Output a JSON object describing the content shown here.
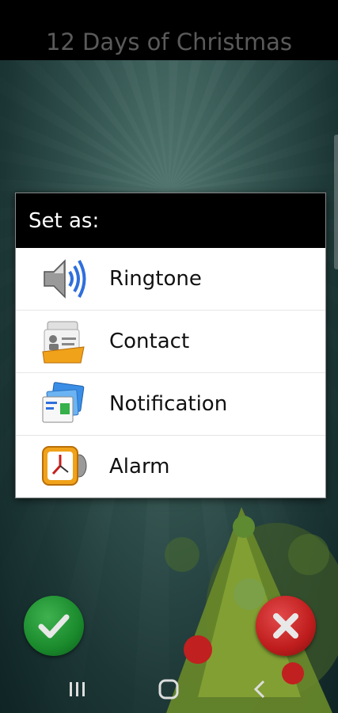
{
  "app": {
    "title": "12 Days of Christmas"
  },
  "dialog": {
    "title": "Set as:",
    "items": [
      {
        "label": "Ringtone",
        "icon": "speaker-icon"
      },
      {
        "label": "Contact",
        "icon": "contact-card-icon"
      },
      {
        "label": "Notification",
        "icon": "notification-icon"
      },
      {
        "label": "Alarm",
        "icon": "alarm-clock-icon"
      }
    ]
  },
  "actions": {
    "confirm_icon": "checkmark-icon",
    "cancel_icon": "close-icon"
  },
  "navbar": {
    "recent_icon": "recent-apps-icon",
    "home_icon": "home-icon",
    "back_icon": "back-icon"
  },
  "colors": {
    "confirm": "#1f8f30",
    "cancel": "#c21f1f",
    "header_bg": "#000000"
  }
}
